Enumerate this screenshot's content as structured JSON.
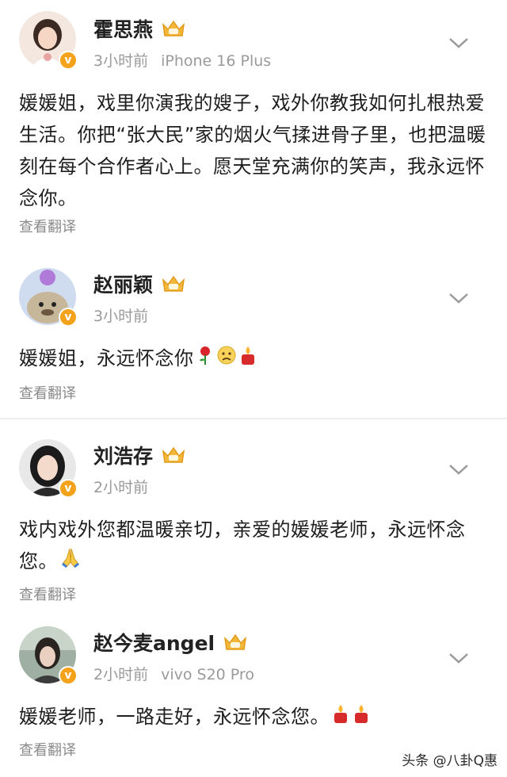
{
  "posts": [
    {
      "name": "霍思燕",
      "time": "3小时前",
      "device": "iPhone 16 Plus",
      "content": "媛媛姐，戏里你演我的嫂子，戏外你教我如何扎根热爱生活。你把“张大民”家的烟火气揉进骨子里，也把温暖刻在每个合作者心上。愿天堂充满你的笑声，我永远怀念你。",
      "translate": "查看翻译",
      "emojis": []
    },
    {
      "name": "赵丽颖",
      "time": "3小时前",
      "device": "",
      "content": "媛媛姐，永远怀念你",
      "translate": "查看翻译",
      "emojis": [
        "rose-icon",
        "sad-face-icon",
        "candle-icon"
      ]
    },
    {
      "name": "刘浩存",
      "time": "2小时前",
      "device": "",
      "content": "戏内戏外您都温暖亲切，亲爱的媛媛老师，永远怀念您。",
      "translate": "查看翻译",
      "emojis": [
        "praying-hands-icon"
      ]
    },
    {
      "name": "赵今麦angel",
      "time": "2小时前",
      "device": "vivo S20 Pro",
      "content": "媛媛老师，一路走好，永远怀念您。",
      "translate": "查看翻译",
      "emojis": [
        "candle-icon",
        "candle-icon"
      ]
    }
  ],
  "verified_badge": "v",
  "watermark": "头条 @八卦Q惠",
  "colors": {
    "accent": "#f5a21b",
    "meta": "#9a9a9a",
    "divider": "#eeeeee"
  }
}
